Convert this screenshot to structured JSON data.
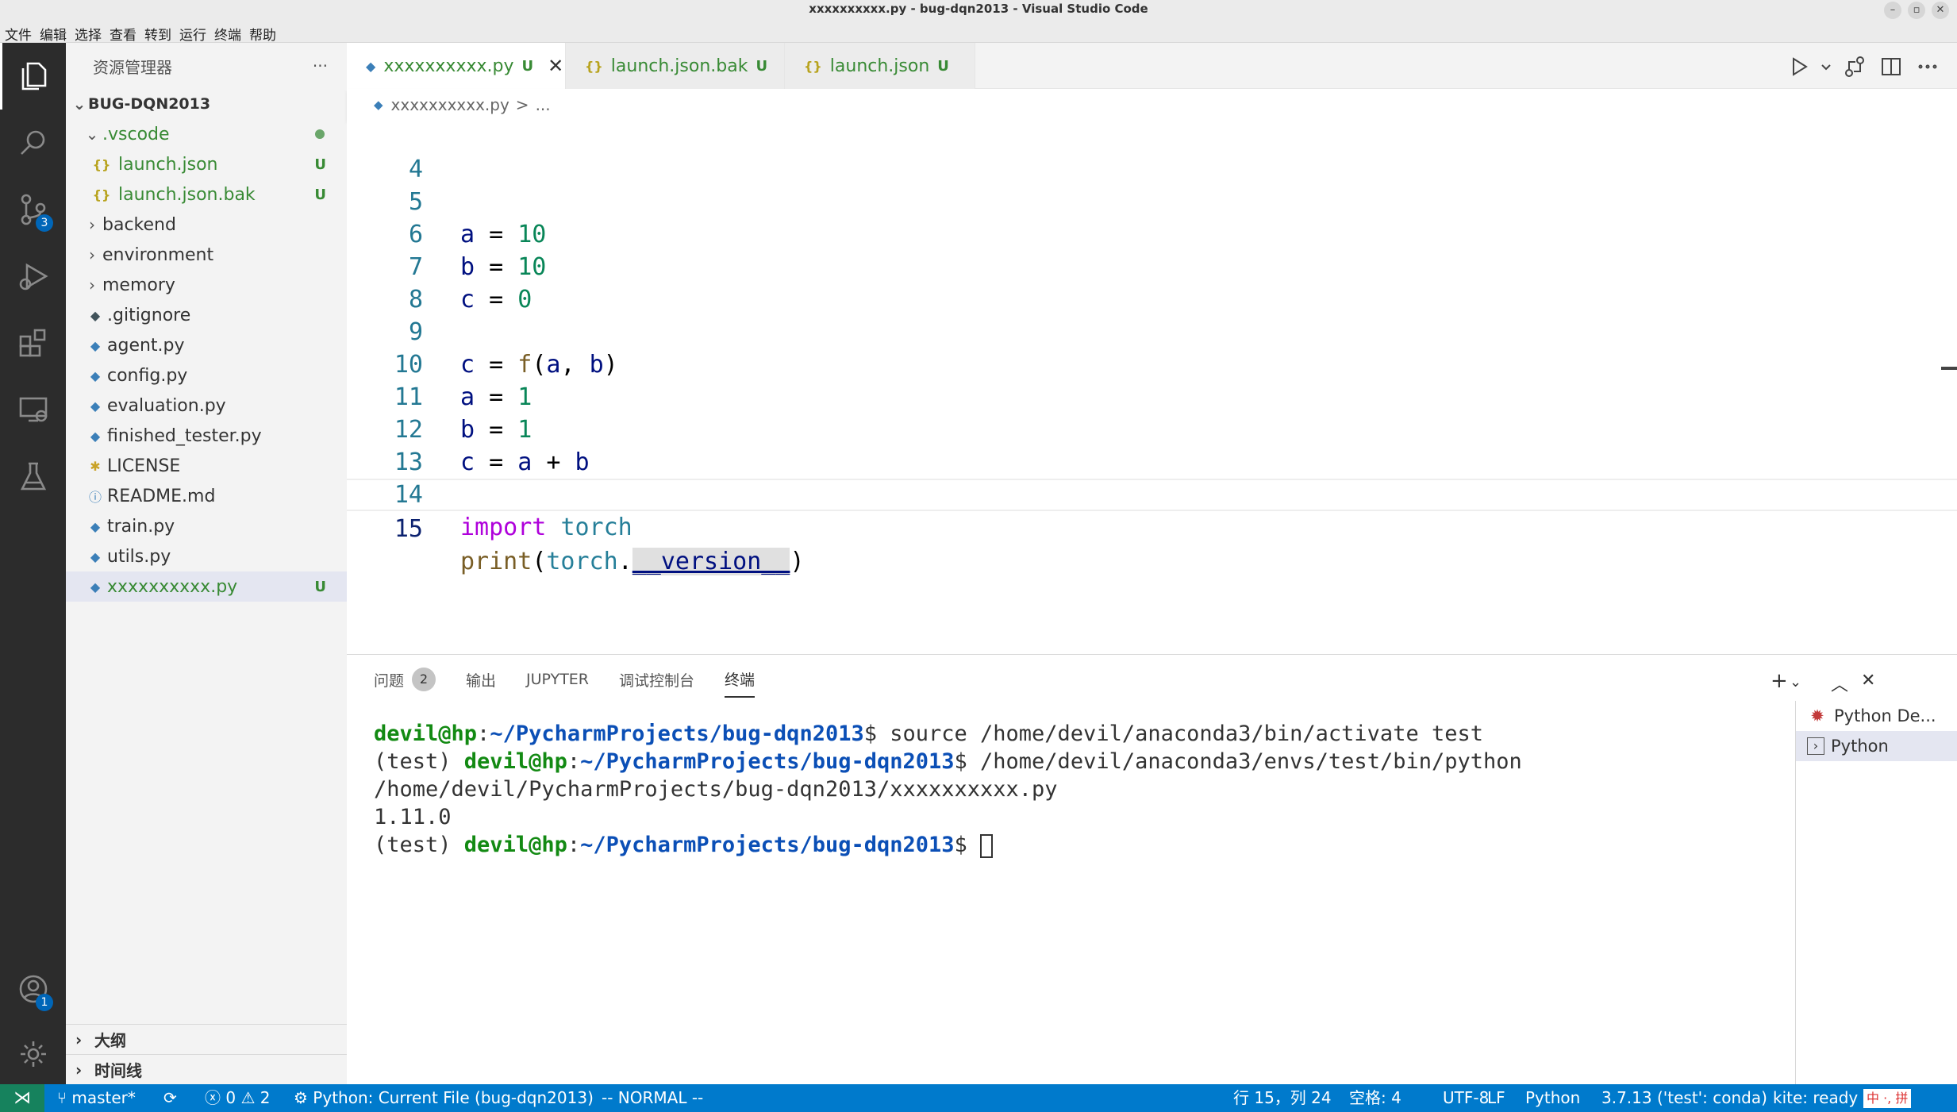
{
  "window": {
    "title": "xxxxxxxxxx.py - bug-dqn2013 - Visual Studio Code",
    "menu": [
      "文件",
      "编辑",
      "选择",
      "查看",
      "转到",
      "运行",
      "终端",
      "帮助"
    ]
  },
  "activity_bar": {
    "scm_badge": "3",
    "accounts_badge": "1"
  },
  "sidebar": {
    "title": "资源管理器",
    "more": "···",
    "root": "BUG-DQN2013",
    "items": [
      {
        "label": ".vscode",
        "kind": "folder-open",
        "flag": ""
      },
      {
        "label": "launch.json",
        "kind": "json",
        "flag": "U"
      },
      {
        "label": "launch.json.bak",
        "kind": "json",
        "flag": "U"
      },
      {
        "label": "backend",
        "kind": "folder",
        "flag": ""
      },
      {
        "label": "environment",
        "kind": "folder",
        "flag": ""
      },
      {
        "label": "memory",
        "kind": "folder",
        "flag": ""
      },
      {
        "label": ".gitignore",
        "kind": "git",
        "flag": ""
      },
      {
        "label": "agent.py",
        "kind": "py",
        "flag": ""
      },
      {
        "label": "config.py",
        "kind": "py",
        "flag": ""
      },
      {
        "label": "evaluation.py",
        "kind": "py",
        "flag": ""
      },
      {
        "label": "finished_tester.py",
        "kind": "py",
        "flag": ""
      },
      {
        "label": "LICENSE",
        "kind": "license",
        "flag": ""
      },
      {
        "label": "README.md",
        "kind": "info",
        "flag": ""
      },
      {
        "label": "train.py",
        "kind": "py",
        "flag": ""
      },
      {
        "label": "utils.py",
        "kind": "py",
        "flag": ""
      },
      {
        "label": "xxxxxxxxxx.py",
        "kind": "py",
        "flag": "U"
      }
    ],
    "outline_label": "大纲",
    "timeline_label": "时间线"
  },
  "tabs": [
    {
      "label": "xxxxxxxxxx.py",
      "flag": "U",
      "active": true
    },
    {
      "label": "launch.json.bak",
      "flag": "U",
      "active": false
    },
    {
      "label": "launch.json",
      "flag": "U",
      "active": false
    }
  ],
  "breadcrumb": {
    "file": "xxxxxxxxxx.py",
    "sep": ">",
    "rest": "..."
  },
  "editor": {
    "lines": [
      {
        "n": "4"
      },
      {
        "n": "5"
      },
      {
        "n": "6"
      },
      {
        "n": "7"
      },
      {
        "n": "8"
      },
      {
        "n": "9"
      },
      {
        "n": "10"
      },
      {
        "n": "11"
      },
      {
        "n": "12"
      },
      {
        "n": "13"
      },
      {
        "n": "14"
      },
      {
        "n": "15"
      }
    ],
    "code": {
      "l5_var": "a",
      "l5_op": " = ",
      "l5_val": "10",
      "l6_var": "b",
      "l6_op": " = ",
      "l6_val": "10",
      "l7_var": "c",
      "l7_op": " = ",
      "l7_val": "0",
      "l9_a": "c",
      "l9_b": " = ",
      "l9_fn": "f",
      "l9_c": "(",
      "l9_d": "a",
      "l9_e": ", ",
      "l9_f": "b",
      "l9_g": ")",
      "l10_var": "a",
      "l10_op": " = ",
      "l10_val": "1",
      "l11_var": "b",
      "l11_op": " = ",
      "l11_val": "1",
      "l12_a": "c",
      "l12_b": " = ",
      "l12_c": "a",
      "l12_d": " + ",
      "l12_e": "b",
      "l14_kw": "import",
      "l14_sp": " ",
      "l14_mod": "torch",
      "l15_fn": "print",
      "l15_p": "(",
      "l15_mod": "torch",
      "l15_dot": ".",
      "l15_attr": "__version__",
      "l15_end": ")"
    }
  },
  "panel": {
    "tabs": [
      {
        "label": "问题",
        "count": "2"
      },
      {
        "label": "输出"
      },
      {
        "label": "JUPYTER"
      },
      {
        "label": "调试控制台"
      },
      {
        "label": "终端"
      }
    ],
    "terminal": {
      "l1_user": "devil@hp",
      "l1_colon": ":",
      "l1_path": "~/PycharmProjects/bug-dqn2013",
      "l1_cmd": "$ source /home/devil/anaconda3/bin/activate test",
      "l2_env": "(test) ",
      "l2_user": "devil@hp",
      "l2_colon": ":",
      "l2_path": "~/PycharmProjects/bug-dqn2013",
      "l2_cmd": "$ /home/devil/anaconda3/envs/test/bin/python /home/devil/PycharmProjects/bug-dqn2013/xxxxxxxxxx.py",
      "l3_out": "1.11.0",
      "l4_env": "(test) ",
      "l4_user": "devil@hp",
      "l4_colon": ":",
      "l4_path": "~/PycharmProjects/bug-dqn2013",
      "l4_cmd": "$ "
    },
    "terminals": [
      {
        "label": "Python De..."
      },
      {
        "label": "Python"
      }
    ]
  },
  "statusbar": {
    "branch": "master*",
    "errors": "0",
    "warnings": "2",
    "debug_config": "Python: Current File (bug-dqn2013)",
    "vim_mode": "-- NORMAL --",
    "cursor_pos": "行 15，列 24",
    "indent": "空格: 4",
    "encoding": "UTF-8",
    "eol": "LF",
    "language": "Python",
    "interpreter": "3.7.13 ('test': conda)",
    "kite": "kite: ready",
    "ime": "中 ·, 拼"
  },
  "colors": {
    "accent": "#007acc",
    "remote": "#16825d",
    "git_untracked": "#388a34",
    "activity_bg": "#2c2c2c"
  }
}
